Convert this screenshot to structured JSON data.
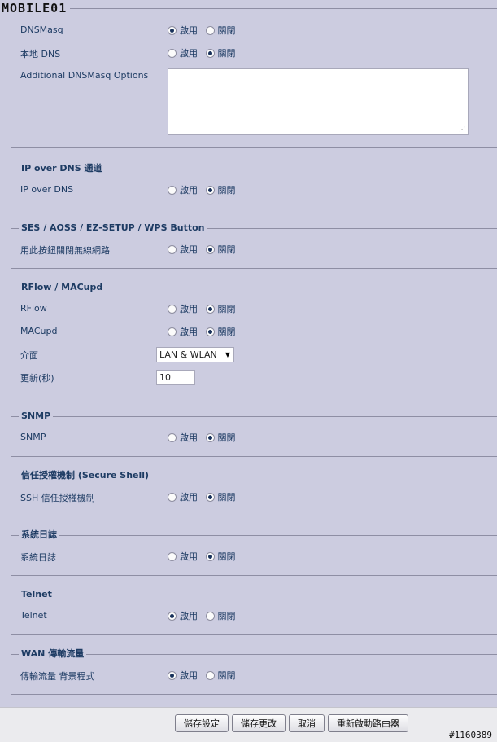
{
  "watermark": {
    "logo": "MOBILE01",
    "id": "#1160389"
  },
  "radio_labels": {
    "enable": "啟用",
    "disable": "關閉"
  },
  "sections": [
    {
      "legend": "",
      "rows": [
        {
          "label": "DNSMasq",
          "value": "enable"
        },
        {
          "label": "本地 DNS",
          "value": "disable"
        },
        {
          "label": "Additional DNSMasq Options",
          "textarea": ""
        }
      ]
    },
    {
      "legend": "IP over DNS 通道",
      "rows": [
        {
          "label": "IP over DNS",
          "value": "disable"
        }
      ]
    },
    {
      "legend": "SES / AOSS / EZ-SETUP / WPS Button",
      "rows": [
        {
          "label": "用此按鈕關閉無線網路",
          "value": "disable"
        }
      ]
    },
    {
      "legend": "RFlow / MACupd",
      "rows": [
        {
          "label": "RFlow",
          "value": "disable"
        },
        {
          "label": "MACupd",
          "value": "disable"
        },
        {
          "label": "介面",
          "select": "LAN & WLAN"
        },
        {
          "label": "更新(秒)",
          "input": "10"
        }
      ]
    },
    {
      "legend": "SNMP",
      "rows": [
        {
          "label": "SNMP",
          "value": "disable"
        }
      ]
    },
    {
      "legend": "信任授權機制 (Secure Shell)",
      "rows": [
        {
          "label": "SSH 信任授權機制",
          "value": "disable"
        }
      ]
    },
    {
      "legend": "系統日誌",
      "rows": [
        {
          "label": "系統日誌",
          "value": "disable"
        }
      ]
    },
    {
      "legend": "Telnet",
      "rows": [
        {
          "label": "Telnet",
          "value": "enable"
        }
      ]
    },
    {
      "legend": "WAN 傳輸流量",
      "rows": [
        {
          "label": "傳輸流量 背景程式",
          "value": "enable"
        }
      ]
    }
  ],
  "buttons": {
    "save": "儲存設定",
    "apply": "儲存更改",
    "cancel": "取消",
    "reboot": "重新啟動路由器"
  }
}
